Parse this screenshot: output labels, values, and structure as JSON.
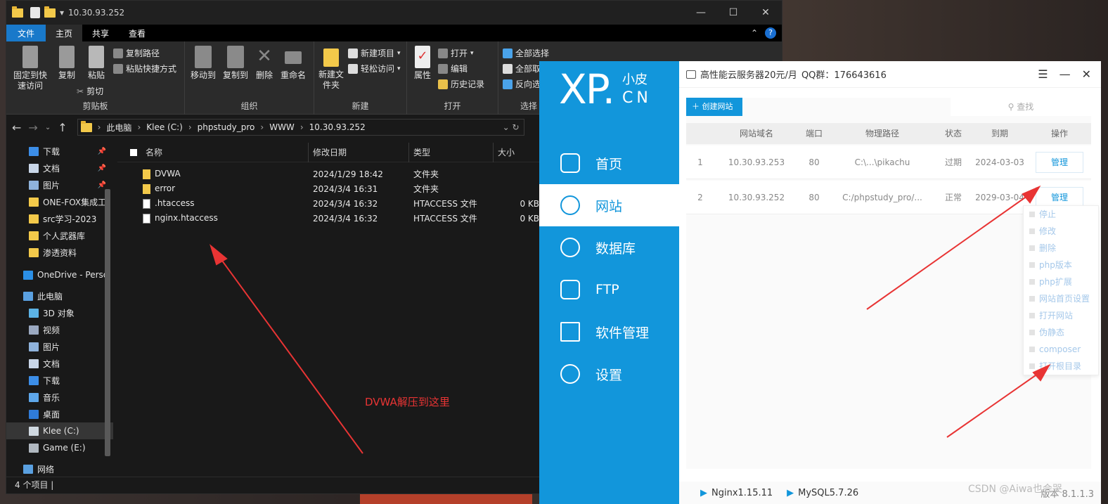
{
  "explorer": {
    "title": "10.30.93.252",
    "tabs": [
      "文件",
      "主页",
      "共享",
      "查看"
    ],
    "active_tab": "主页",
    "ribbon": {
      "clipboard": {
        "label": "剪贴板",
        "pin": "固定到快速访问",
        "copy": "复制",
        "paste": "粘贴",
        "copy_path": "复制路径",
        "paste_shortcut": "粘贴快捷方式",
        "cut": "剪切"
      },
      "organize": {
        "label": "组织",
        "move_to": "移动到",
        "copy_to": "复制到",
        "delete": "删除",
        "rename": "重命名"
      },
      "new": {
        "label": "新建",
        "new_folder": "新建文件夹",
        "new_item": "新建项目",
        "easy_access": "轻松访问"
      },
      "open": {
        "label": "打开",
        "properties": "属性",
        "open": "打开",
        "edit": "编辑",
        "history": "历史记录"
      },
      "select": {
        "label": "选择",
        "select_all": "全部选择",
        "select_none": "全部取",
        "invert": "反向选"
      }
    },
    "breadcrumb": [
      "此电脑",
      "Klee (C:)",
      "phpstudy_pro",
      "WWW",
      "10.30.93.252"
    ],
    "sidebar": [
      {
        "label": "下载",
        "pinned": true
      },
      {
        "label": "文档",
        "pinned": true
      },
      {
        "label": "图片",
        "pinned": true
      },
      {
        "label": "ONE-FOX集成工"
      },
      {
        "label": "src学习-2023"
      },
      {
        "label": "个人武器库"
      },
      {
        "label": "渗透资料"
      },
      {
        "label": "OneDrive - Perso"
      },
      {
        "label": "此电脑"
      },
      {
        "label": "3D 对象"
      },
      {
        "label": "视频"
      },
      {
        "label": "图片"
      },
      {
        "label": "文档"
      },
      {
        "label": "下载"
      },
      {
        "label": "音乐"
      },
      {
        "label": "桌面"
      },
      {
        "label": "Klee (C:)",
        "selected": true
      },
      {
        "label": "Game (E:)"
      },
      {
        "label": "网络"
      }
    ],
    "columns": [
      "名称",
      "修改日期",
      "类型",
      "大小"
    ],
    "files": [
      {
        "name": "DVWA",
        "date": "2024/1/29 18:42",
        "type": "文件夹",
        "size": "",
        "kind": "folder"
      },
      {
        "name": "error",
        "date": "2024/3/4 16:31",
        "type": "文件夹",
        "size": "",
        "kind": "folder"
      },
      {
        "name": ".htaccess",
        "date": "2024/3/4 16:32",
        "type": "HTACCESS 文件",
        "size": "0 KB",
        "kind": "file"
      },
      {
        "name": "nginx.htaccess",
        "date": "2024/3/4 16:32",
        "type": "HTACCESS 文件",
        "size": "0 KB",
        "kind": "file"
      }
    ],
    "status": "4 个项目",
    "annotation": "DVWA解压到这里"
  },
  "xp": {
    "logo_big": "XP.",
    "logo_cn1": "小皮",
    "logo_cn2": "CN",
    "nav": [
      "首页",
      "网站",
      "数据库",
      "FTP",
      "软件管理",
      "设置"
    ],
    "active_nav": "网站",
    "ad": "高性能云服务器20元/月",
    "qq": "QQ群：176643616",
    "create_site": "创建网站",
    "search_placeholder": "查找",
    "table_headers": [
      "",
      "网站域名",
      "端口",
      "物理路径",
      "状态",
      "到期",
      "操作"
    ],
    "rows": [
      {
        "idx": "1",
        "domain": "10.30.93.253",
        "port": "80",
        "path": "C:\\...\\pikachu",
        "status": "过期",
        "expire": "2024-03-03",
        "action": "管理"
      },
      {
        "idx": "2",
        "domain": "10.30.93.252",
        "port": "80",
        "path": "C:/phpstudy_pro/...",
        "status": "正常",
        "expire": "2029-03-04",
        "action": "管理"
      }
    ],
    "manage_menu": [
      "停止",
      "修改",
      "删除",
      "php版本",
      "php扩展",
      "网站首页设置",
      "打开网站",
      "伪静态",
      "composer",
      "打开根目录"
    ],
    "footer": {
      "nginx": "Nginx1.15.11",
      "mysql": "MySQL5.7.26",
      "version": "版本 8.1.1.3"
    },
    "watermark": "CSDN @Aiwa也会哭"
  },
  "colors": {
    "xp_blue": "#1296db",
    "explorer_file_tab": "#1979ca",
    "annotation_red": "#e83434"
  }
}
